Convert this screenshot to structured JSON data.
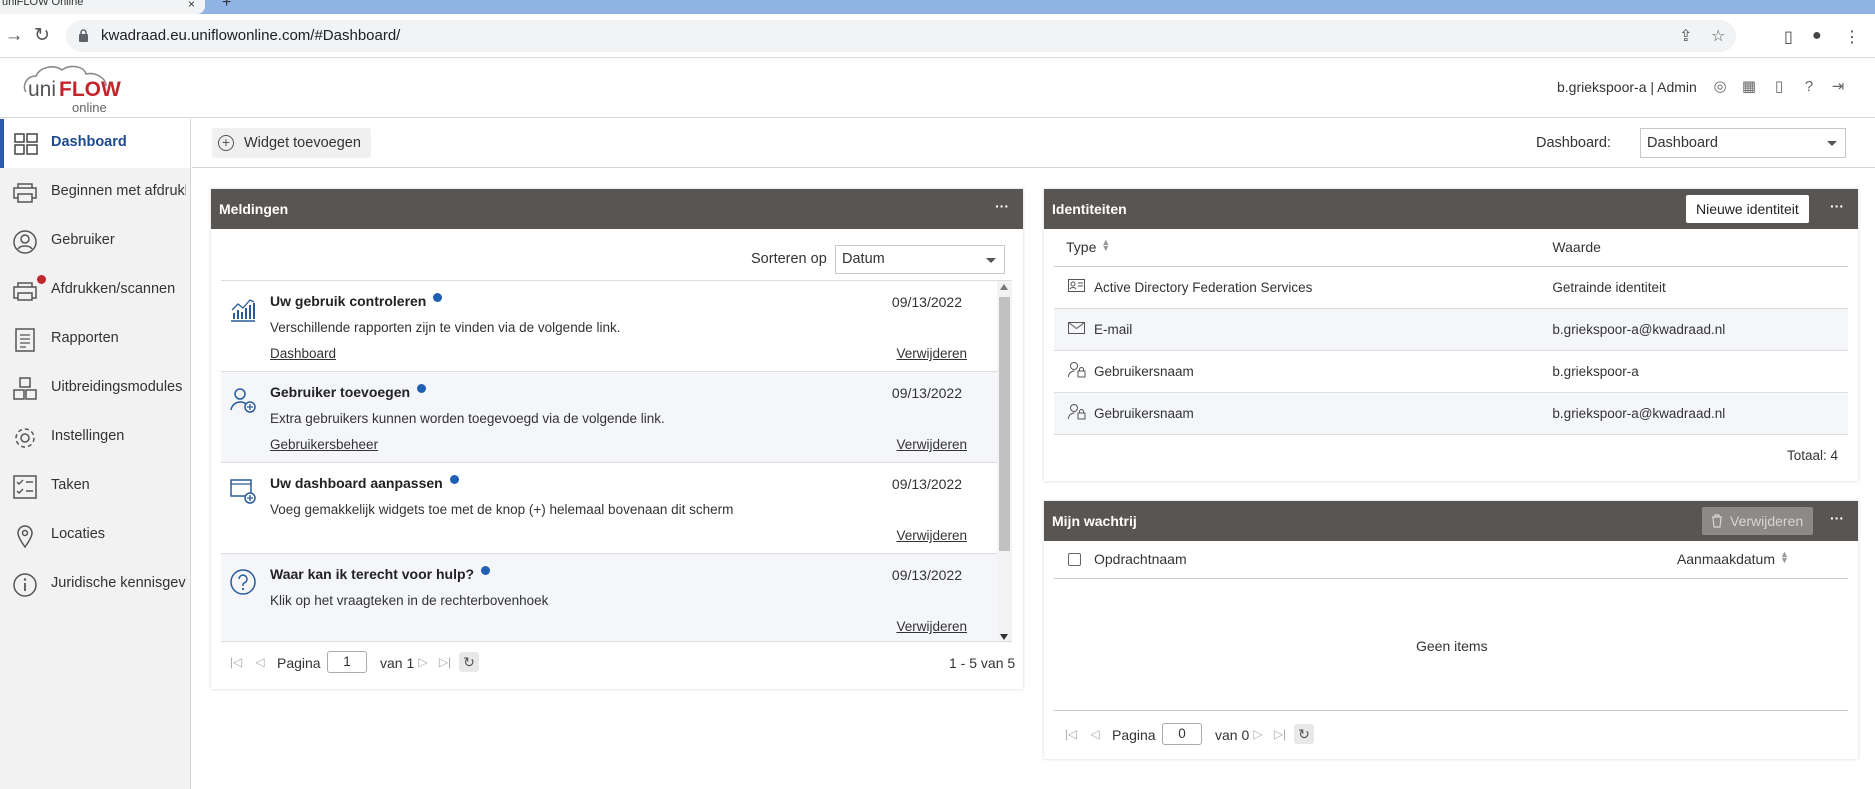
{
  "browser": {
    "tab_title": "uniFLOW Online",
    "url": "kwadraad.eu.uniflowonline.com/#Dashboard/"
  },
  "header": {
    "logo_text_uni": "uni",
    "logo_text_flow": "FLOW",
    "logo_text_online": "online",
    "user": "b.griekspoor-a | Admin"
  },
  "sidebar": {
    "items": [
      {
        "label": "Dashboard",
        "icon": "dashboard-icon"
      },
      {
        "label": "Beginnen met afdrukken",
        "icon": "printer-icon"
      },
      {
        "label": "Gebruiker",
        "icon": "user-icon"
      },
      {
        "label": "Afdrukken/scannen",
        "icon": "print-scan-icon"
      },
      {
        "label": "Rapporten",
        "icon": "report-icon"
      },
      {
        "label": "Uitbreidingsmodules",
        "icon": "modules-icon"
      },
      {
        "label": "Instellingen",
        "icon": "gear-icon"
      },
      {
        "label": "Taken",
        "icon": "tasks-icon"
      },
      {
        "label": "Locaties",
        "icon": "location-icon"
      },
      {
        "label": "Juridische kennisgevingen",
        "icon": "info-icon"
      }
    ]
  },
  "topbar": {
    "add_widget": "Widget toevoegen",
    "dashboard_label": "Dashboard:",
    "dashboard_value": "Dashboard"
  },
  "meldingen": {
    "title": "Meldingen",
    "more": "···",
    "sort_label": "Sorteren op",
    "sort_value": "Datum",
    "items": [
      {
        "title": "Uw gebruik controleren",
        "date": "09/13/2022",
        "text": "Verschillende rapporten zijn te vinden via de volgende link.",
        "link": "Dashboard",
        "delete": "Verwijderen"
      },
      {
        "title": "Gebruiker toevoegen",
        "date": "09/13/2022",
        "text": "Extra gebruikers kunnen worden toegevoegd via de volgende link.",
        "link": "Gebruikersbeheer",
        "delete": "Verwijderen"
      },
      {
        "title": "Uw dashboard aanpassen",
        "date": "09/13/2022",
        "text": "Voeg gemakkelijk widgets toe met de knop (+) helemaal bovenaan dit scherm",
        "link": "",
        "delete": "Verwijderen"
      },
      {
        "title": "Waar kan ik terecht voor hulp?",
        "date": "09/13/2022",
        "text": "Klik op het vraagteken in de rechterbovenhoek",
        "link": "",
        "delete": "Verwijderen"
      }
    ],
    "pager": {
      "page_label": "Pagina",
      "page": "1",
      "of": "van 1",
      "summary": "1 - 5 van 5"
    }
  },
  "identiteiten": {
    "title": "Identiteiten",
    "new_button": "Nieuwe identiteit",
    "more": "···",
    "col_type": "Type",
    "col_value": "Waarde",
    "rows": [
      {
        "type": "Active Directory Federation Services",
        "value": "Getrainde identiteit",
        "icon": "id-card-icon"
      },
      {
        "type": "E-mail",
        "value": "b.griekspoor-a@kwadraad.nl",
        "icon": "mail-icon"
      },
      {
        "type": "Gebruikersnaam",
        "value": "b.griekspoor-a",
        "icon": "user-lock-icon"
      },
      {
        "type": "Gebruikersnaam",
        "value": "b.griekspoor-a@kwadraad.nl",
        "icon": "user-lock-icon"
      }
    ],
    "total": "Totaal: 4"
  },
  "wachtrij": {
    "title": "Mijn wachtrij",
    "delete_button": "Verwijderen",
    "more": "···",
    "col_name": "Opdrachtnaam",
    "col_date": "Aanmaakdatum",
    "empty": "Geen items",
    "pager": {
      "page_label": "Pagina",
      "page": "0",
      "of": "van 0"
    }
  },
  "colors": {
    "panel_header": "#595553",
    "accent": "#1d4a8f",
    "notification_dot": "#c0262b",
    "unread_dot": "#1f5fb4"
  }
}
